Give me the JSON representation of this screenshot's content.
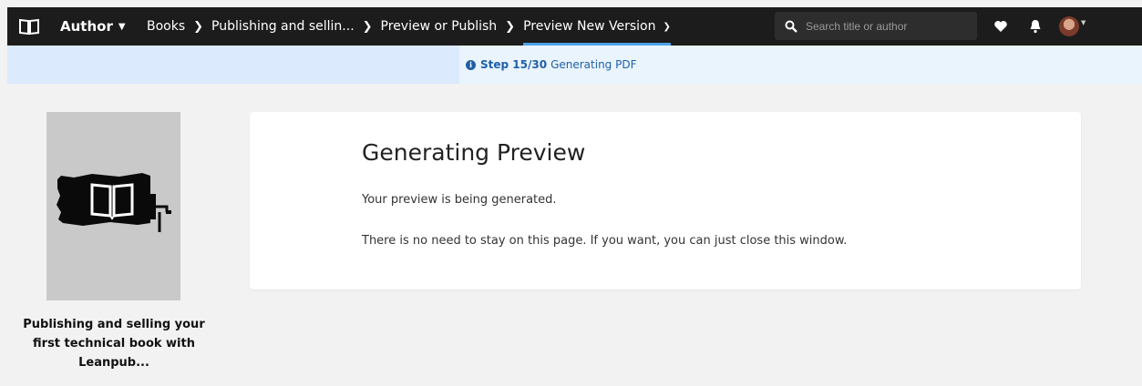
{
  "nav": {
    "author_label": "Author",
    "breadcrumbs": [
      "Books",
      "Publishing and sellin...",
      "Preview or Publish",
      "Preview New Version"
    ],
    "search_placeholder": "Search title or author",
    "icons": [
      "book-logo-icon",
      "heart-icon",
      "bell-icon",
      "avatar"
    ],
    "accent_color": "#4da3e8"
  },
  "step": {
    "label": "Step 15/30",
    "status": "Generating PDF",
    "color": "#1f5fa8"
  },
  "book": {
    "title": "Publishing and selling your first technical book with Leanpub..."
  },
  "main": {
    "heading": "Generating Preview",
    "line1": "Your preview is being generated.",
    "line2": "There is no need to stay on this page. If you want, you can just close this window."
  }
}
